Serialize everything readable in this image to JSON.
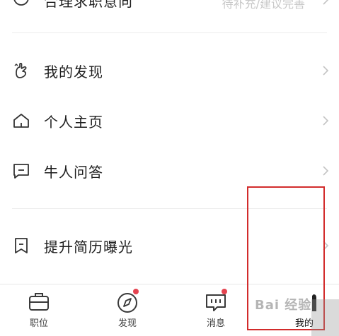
{
  "top_row": {
    "label": "合理求职意向",
    "right_text": "待补充/建议完善"
  },
  "menu": {
    "items": [
      {
        "label": "我的发现",
        "icon": "hand-heart-icon"
      },
      {
        "label": "个人主页",
        "icon": "home-icon"
      },
      {
        "label": "牛人问答",
        "icon": "chat-square-icon"
      },
      {
        "label": "提升简历曝光",
        "icon": "bookmark-icon"
      }
    ]
  },
  "tabbar": {
    "tabs": [
      {
        "label": "职位",
        "icon": "briefcase-icon",
        "badge": false
      },
      {
        "label": "发现",
        "icon": "compass-icon",
        "badge": true
      },
      {
        "label": "消息",
        "icon": "message-icon",
        "badge": true
      },
      {
        "label": "我的",
        "icon": "profile-icon",
        "badge": false,
        "active": true
      }
    ]
  },
  "watermark": {
    "text": "Bai 经验"
  },
  "colors": {
    "badge": "#e4434f",
    "highlight_box": "#d22b2b",
    "divider": "#ededed",
    "chevron": "#c4c4c4"
  }
}
